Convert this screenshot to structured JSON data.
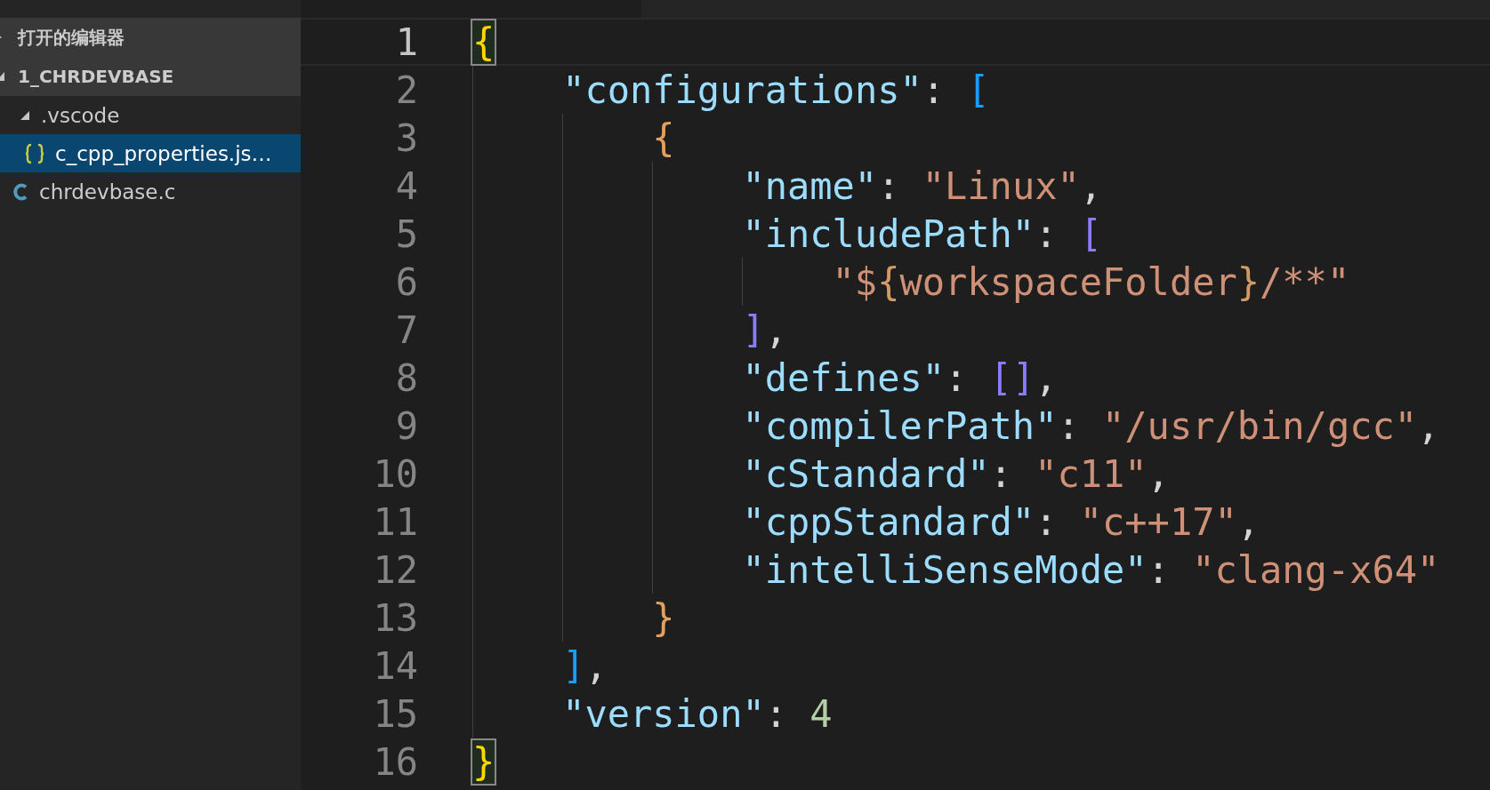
{
  "sidebar": {
    "sections": [
      {
        "title": "打开的编辑器",
        "expanded": false
      },
      {
        "title": "1_CHRDEVBASE",
        "expanded": true,
        "children": [
          {
            "name": ".vscode",
            "kind": "folder",
            "expanded": true,
            "selected": false,
            "children": [
              {
                "name": "c_cpp_properties.js…",
                "kind": "json",
                "selected": true
              }
            ]
          },
          {
            "name": "chrdevbase.c",
            "kind": "c",
            "selected": false
          }
        ]
      }
    ]
  },
  "editor": {
    "lines": [
      {
        "number": "1",
        "current": true,
        "tokens": [
          {
            "text": "{",
            "kind": "brace1",
            "matched": true
          }
        ]
      },
      {
        "number": "2",
        "current": false,
        "tokens": [
          {
            "text": "    \"configurations\"",
            "kind": "key"
          },
          {
            "text": ": ",
            "kind": "punct"
          },
          {
            "text": "[",
            "kind": "bracket2"
          }
        ]
      },
      {
        "number": "3",
        "current": false,
        "tokens": [
          {
            "text": "        {",
            "kind": "brace3"
          }
        ]
      },
      {
        "number": "4",
        "current": false,
        "tokens": [
          {
            "text": "            \"name\"",
            "kind": "key"
          },
          {
            "text": ": ",
            "kind": "punct"
          },
          {
            "text": "\"Linux\"",
            "kind": "string"
          },
          {
            "text": ",",
            "kind": "punct"
          }
        ]
      },
      {
        "number": "5",
        "current": false,
        "tokens": [
          {
            "text": "            \"includePath\"",
            "kind": "key"
          },
          {
            "text": ": ",
            "kind": "punct"
          },
          {
            "text": "[",
            "kind": "bracket4"
          }
        ]
      },
      {
        "number": "6",
        "current": false,
        "tokens": [
          {
            "text": "                \"$",
            "kind": "string"
          },
          {
            "text": "{",
            "kind": "brace5"
          },
          {
            "text": "workspaceFolder",
            "kind": "string"
          },
          {
            "text": "}",
            "kind": "brace5"
          },
          {
            "text": "/**\"",
            "kind": "string"
          }
        ]
      },
      {
        "number": "7",
        "current": false,
        "tokens": [
          {
            "text": "            ]",
            "kind": "bracket4"
          },
          {
            "text": ",",
            "kind": "punct"
          }
        ]
      },
      {
        "number": "8",
        "current": false,
        "tokens": [
          {
            "text": "            \"defines\"",
            "kind": "key"
          },
          {
            "text": ": ",
            "kind": "punct"
          },
          {
            "text": "[]",
            "kind": "bracket4"
          },
          {
            "text": ",",
            "kind": "punct"
          }
        ]
      },
      {
        "number": "9",
        "current": false,
        "tokens": [
          {
            "text": "            \"compilerPath\"",
            "kind": "key"
          },
          {
            "text": ": ",
            "kind": "punct"
          },
          {
            "text": "\"/usr/bin/gcc\"",
            "kind": "string"
          },
          {
            "text": ",",
            "kind": "punct"
          }
        ]
      },
      {
        "number": "10",
        "current": false,
        "tokens": [
          {
            "text": "            \"cStandard\"",
            "kind": "key"
          },
          {
            "text": ": ",
            "kind": "punct"
          },
          {
            "text": "\"c11\"",
            "kind": "string"
          },
          {
            "text": ",",
            "kind": "punct"
          }
        ]
      },
      {
        "number": "11",
        "current": false,
        "tokens": [
          {
            "text": "            \"cppStandard\"",
            "kind": "key"
          },
          {
            "text": ": ",
            "kind": "punct"
          },
          {
            "text": "\"c++17\"",
            "kind": "string"
          },
          {
            "text": ",",
            "kind": "punct"
          }
        ]
      },
      {
        "number": "12",
        "current": false,
        "tokens": [
          {
            "text": "            \"intelliSenseMode\"",
            "kind": "key"
          },
          {
            "text": ": ",
            "kind": "punct"
          },
          {
            "text": "\"clang-x64\"",
            "kind": "string"
          }
        ]
      },
      {
        "number": "13",
        "current": false,
        "tokens": [
          {
            "text": "        }",
            "kind": "brace3"
          }
        ]
      },
      {
        "number": "14",
        "current": false,
        "tokens": [
          {
            "text": "    ]",
            "kind": "bracket2"
          },
          {
            "text": ",",
            "kind": "punct"
          }
        ]
      },
      {
        "number": "15",
        "current": false,
        "tokens": [
          {
            "text": "    \"version\"",
            "kind": "key"
          },
          {
            "text": ": ",
            "kind": "punct"
          },
          {
            "text": "4",
            "kind": "number"
          }
        ]
      },
      {
        "number": "16",
        "current": false,
        "tokens": [
          {
            "text": "}",
            "kind": "brace1",
            "matched": true
          }
        ]
      }
    ]
  }
}
